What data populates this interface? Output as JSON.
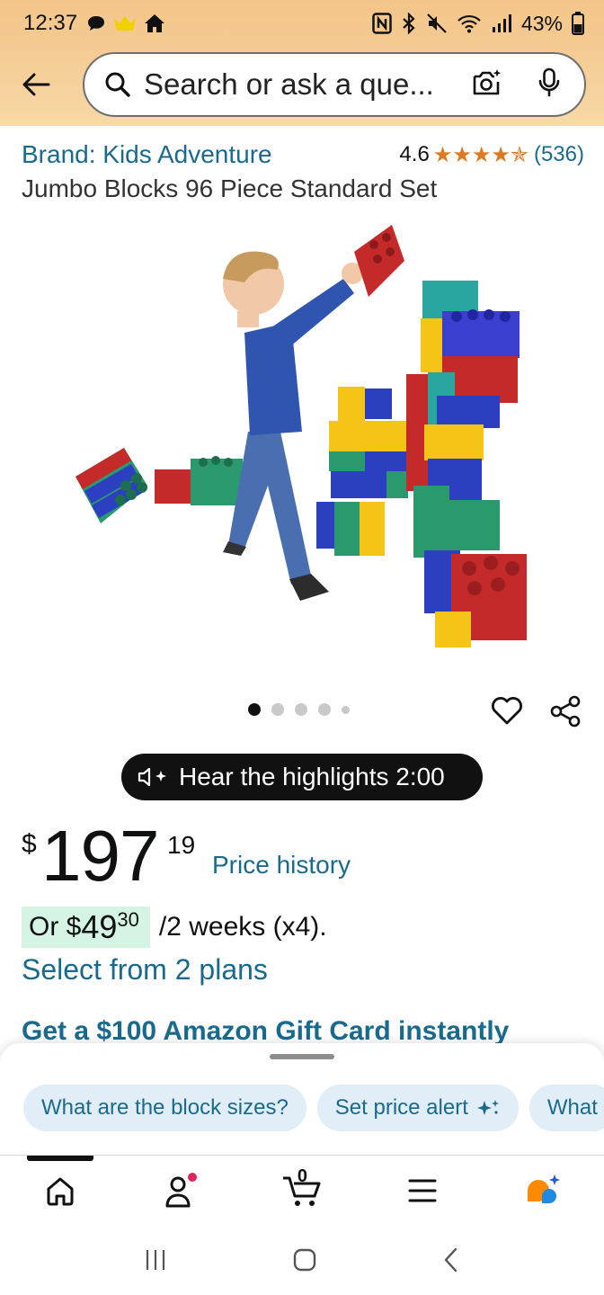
{
  "status_bar": {
    "time": "12:37",
    "battery": "43%"
  },
  "search": {
    "placeholder": "Search or ask a que..."
  },
  "product": {
    "brand": "Brand: Kids Adventure",
    "rating": "4.6",
    "rating_stars": "★★★★✯",
    "review_count": "(536)",
    "title": "Jumbo Blocks 96 Piece Standard Set",
    "image_count": 5,
    "active_image": 1
  },
  "highlights": {
    "label": "Hear the highlights 2:00"
  },
  "price": {
    "currency": "$",
    "whole": "197",
    "fraction": "19",
    "history_link": "Price history"
  },
  "plan": {
    "or": "Or",
    "currency": "$",
    "whole": "49",
    "fraction": "30",
    "terms": "/2 weeks (x4).",
    "select_link": "Select from 2 plans"
  },
  "promo": {
    "text": "Get a $100 Amazon Gift Card instantly"
  },
  "suggestions": [
    {
      "label": "What are the block sizes?"
    },
    {
      "label": "Set price alert"
    },
    {
      "label": "What"
    }
  ],
  "bottom_nav": {
    "cart_count": "0",
    "items": [
      "home-icon",
      "account-icon",
      "cart-icon",
      "menu-icon",
      "rufus-icon"
    ]
  },
  "colors": {
    "header_bg": "#f5cc94",
    "link": "#1a6a8e",
    "star": "#de7921",
    "chip_bg": "#e2eef7",
    "plan_badge": "#d5f4e4"
  }
}
